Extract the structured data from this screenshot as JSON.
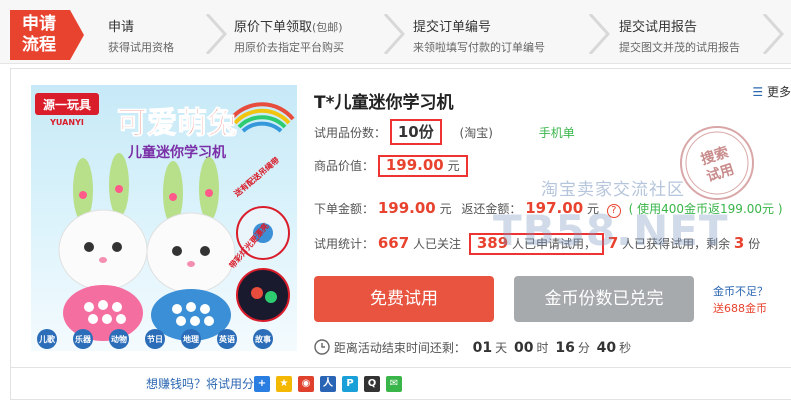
{
  "steps": {
    "badge_line1": "申请",
    "badge_line2": "流程",
    "items": [
      {
        "title": "申请",
        "title_note": "",
        "desc": "获得试用资格"
      },
      {
        "title": "原价下单领取",
        "title_note": "(包邮)",
        "desc": "用原价去指定平台购买"
      },
      {
        "title": "提交订单编号",
        "title_note": "",
        "desc": "来领啦填写付款的订单编号"
      },
      {
        "title": "提交试用报告",
        "title_note": "",
        "desc": "提交图文并茂的试用报告"
      }
    ]
  },
  "product": {
    "image_text": {
      "brand": "源一玩具",
      "brand_en": "YUANYI",
      "headline": "可爱萌兔",
      "sub": "儿童迷你学习机",
      "side1": "送有配送吊绳带",
      "side2": "带彩灯光更漂亮",
      "tags": [
        "儿歌",
        "乐器",
        "动物",
        "节日",
        "地理",
        "英语",
        "故事"
      ]
    },
    "title": "T*儿童迷你学习机",
    "more_icon_label": "更多",
    "qty_label": "试用品份数：",
    "qty_value": "10份",
    "platform": "(淘宝)",
    "mobile": "手机单",
    "price_label": "商品价值：",
    "price_value": "199.00",
    "price_unit": "元",
    "order_label": "下单金额：",
    "order_value": "199.00",
    "order_unit": "元",
    "refund_label": "返还金额：",
    "refund_value": "197.00",
    "refund_unit": "元",
    "refund_note": "( 使用400金币返199.00元 )",
    "stats_label": "试用统计：",
    "stats_follow": "667",
    "stats_follow_text": "人已关注",
    "stats_apply": "389",
    "stats_apply_text": "人已申请试用，",
    "stats_got": "7",
    "stats_got_text": "人已获得试用，剩余",
    "stats_left": "3",
    "stats_left_unit": "份",
    "stamp_line1": "搜索",
    "stamp_line2": "试用"
  },
  "buttons": {
    "free": "免费试用",
    "gold": "金币份数已兑完",
    "coin_q": "金币不足？",
    "coin_gift": "送688金币"
  },
  "timer": {
    "label": "距离活动结束时间还剩：",
    "days": "01",
    "days_unit": "天",
    "hours": "00",
    "hours_unit": "时",
    "mins": "16",
    "mins_unit": "分",
    "secs": "40",
    "secs_unit": "秒"
  },
  "watermark": {
    "line1": "淘宝卖家交流社区",
    "line2": "TB58.NET"
  },
  "share": {
    "text": "想赚钱吗？将试用分",
    "icons": [
      "qzone-icon",
      "weibo-icon",
      "tencent-weibo-icon",
      "renren-icon",
      "kaixin-icon",
      "qq-icon",
      "wechat-icon"
    ]
  },
  "colors": {
    "accent": "#e8432f",
    "highlight_box": "#ee3333",
    "green": "#3ab54a",
    "link": "#2c67b2"
  }
}
